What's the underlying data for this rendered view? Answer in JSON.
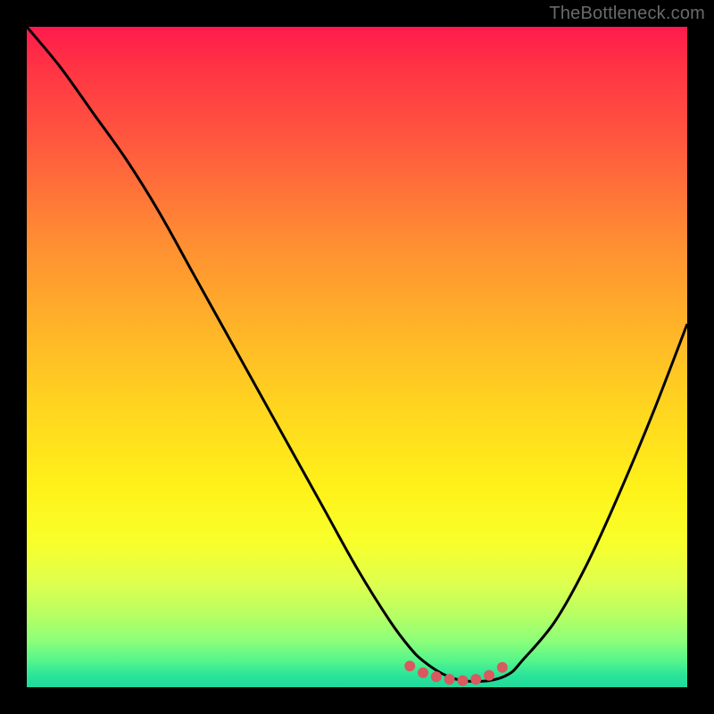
{
  "watermark": "TheBottleneck.com",
  "gradient_colors": {
    "top": "#ff1a4d",
    "upper_mid": "#ffb229",
    "lower_mid": "#fff21a",
    "bottom": "#1ed99c"
  },
  "chart_data": {
    "type": "line",
    "title": "",
    "xlabel": "",
    "ylabel": "",
    "xlim": [
      0,
      100
    ],
    "ylim": [
      0,
      100
    ],
    "x": [
      0,
      5,
      10,
      15,
      20,
      25,
      30,
      35,
      40,
      45,
      50,
      55,
      58,
      60,
      63,
      66,
      70,
      73,
      75,
      80,
      85,
      90,
      95,
      100
    ],
    "values": [
      100,
      94,
      87,
      80,
      72,
      63,
      54,
      45,
      36,
      27,
      18,
      10,
      6,
      4,
      2,
      1,
      1,
      2,
      4,
      10,
      19,
      30,
      42,
      55
    ],
    "annotations": {
      "valley_markers_x": [
        58,
        60,
        62,
        64,
        66,
        68,
        70,
        72
      ],
      "valley_markers_y": [
        3.2,
        2.2,
        1.6,
        1.2,
        1.0,
        1.2,
        1.8,
        3.0
      ],
      "marker_color": "#d9595f",
      "marker_radius": 6
    },
    "curve_color": "#000000",
    "curve_width": 3
  }
}
